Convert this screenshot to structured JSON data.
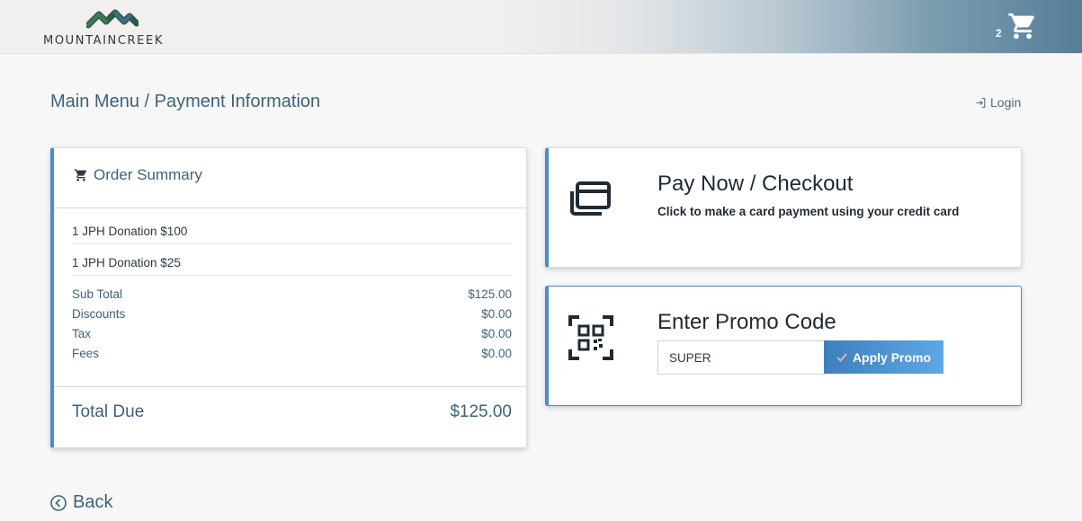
{
  "header": {
    "logo_text_a": "MOUNTAIN",
    "logo_text_b": "CREEK",
    "cart_count": "2",
    "cart_icon": "shopping-cart-icon"
  },
  "breadcrumb": "Main Menu / Payment Information",
  "login_label": "Login",
  "order_summary": {
    "title": "Order Summary",
    "items": [
      "1 JPH Donation $100",
      "1 JPH Donation $25"
    ],
    "rows": [
      {
        "label": "Sub Total",
        "value": "$125.00"
      },
      {
        "label": "Discounts",
        "value": "$0.00"
      },
      {
        "label": "Tax",
        "value": "$0.00"
      },
      {
        "label": "Fees",
        "value": "$0.00"
      }
    ],
    "total_label": "Total Due",
    "total_value": "$125.00"
  },
  "pay_card": {
    "heading": "Pay Now / Checkout",
    "sub": "Click to make a card payment using your credit card",
    "icon": "credit-card-icon"
  },
  "promo_card": {
    "heading": "Enter Promo Code",
    "input_value": "SUPER",
    "button_label": "Apply Promo",
    "icon": "qr-code-icon"
  },
  "back_label": "Back",
  "colors": {
    "accent": "#4b8ccc",
    "text_primary": "#3f6178",
    "header_gradient_end": "#557e97"
  }
}
